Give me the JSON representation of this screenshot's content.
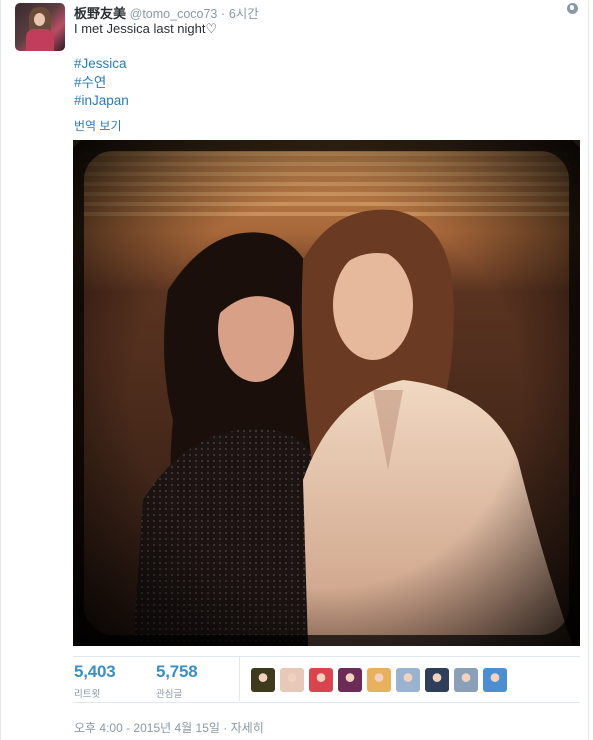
{
  "tweet": {
    "fullname": "板野友美",
    "handle": "@tomo_coco73",
    "separator": "·",
    "time": "6시간",
    "text": "I met Jessica last night♡",
    "hashtags": [
      "#Jessica",
      "#수연",
      "#inJapan"
    ],
    "translate_label": "번역 보기"
  },
  "stats": {
    "retweets": {
      "count": "5,403",
      "label": "리트윗"
    },
    "favorites": {
      "count": "5,758",
      "label": "관심글"
    }
  },
  "favoriter_avatars": [
    {
      "icon": "favoriter-avatar",
      "color": "#3d3a1e"
    },
    {
      "icon": "favoriter-avatar",
      "color": "#e8c9b8"
    },
    {
      "icon": "favoriter-avatar",
      "color": "#d9454f"
    },
    {
      "icon": "favoriter-avatar",
      "color": "#6b2d58"
    },
    {
      "icon": "favoriter-avatar",
      "color": "#e7b15e"
    },
    {
      "icon": "favoriter-avatar",
      "color": "#9ab3d1"
    },
    {
      "icon": "favoriter-avatar",
      "color": "#2f3e5a"
    },
    {
      "icon": "favoriter-avatar",
      "color": "#8aa0b8"
    },
    {
      "icon": "favoriter-avatar",
      "color": "#4b8fd1"
    }
  ],
  "footer": {
    "timestamp": "오후 4:00 - 2015년 4월 15일",
    "separator": "·",
    "details_label": "자세히"
  },
  "colors": {
    "link": "#2b7bb9",
    "count": "#3b8fc4",
    "muted": "#8899a6"
  }
}
